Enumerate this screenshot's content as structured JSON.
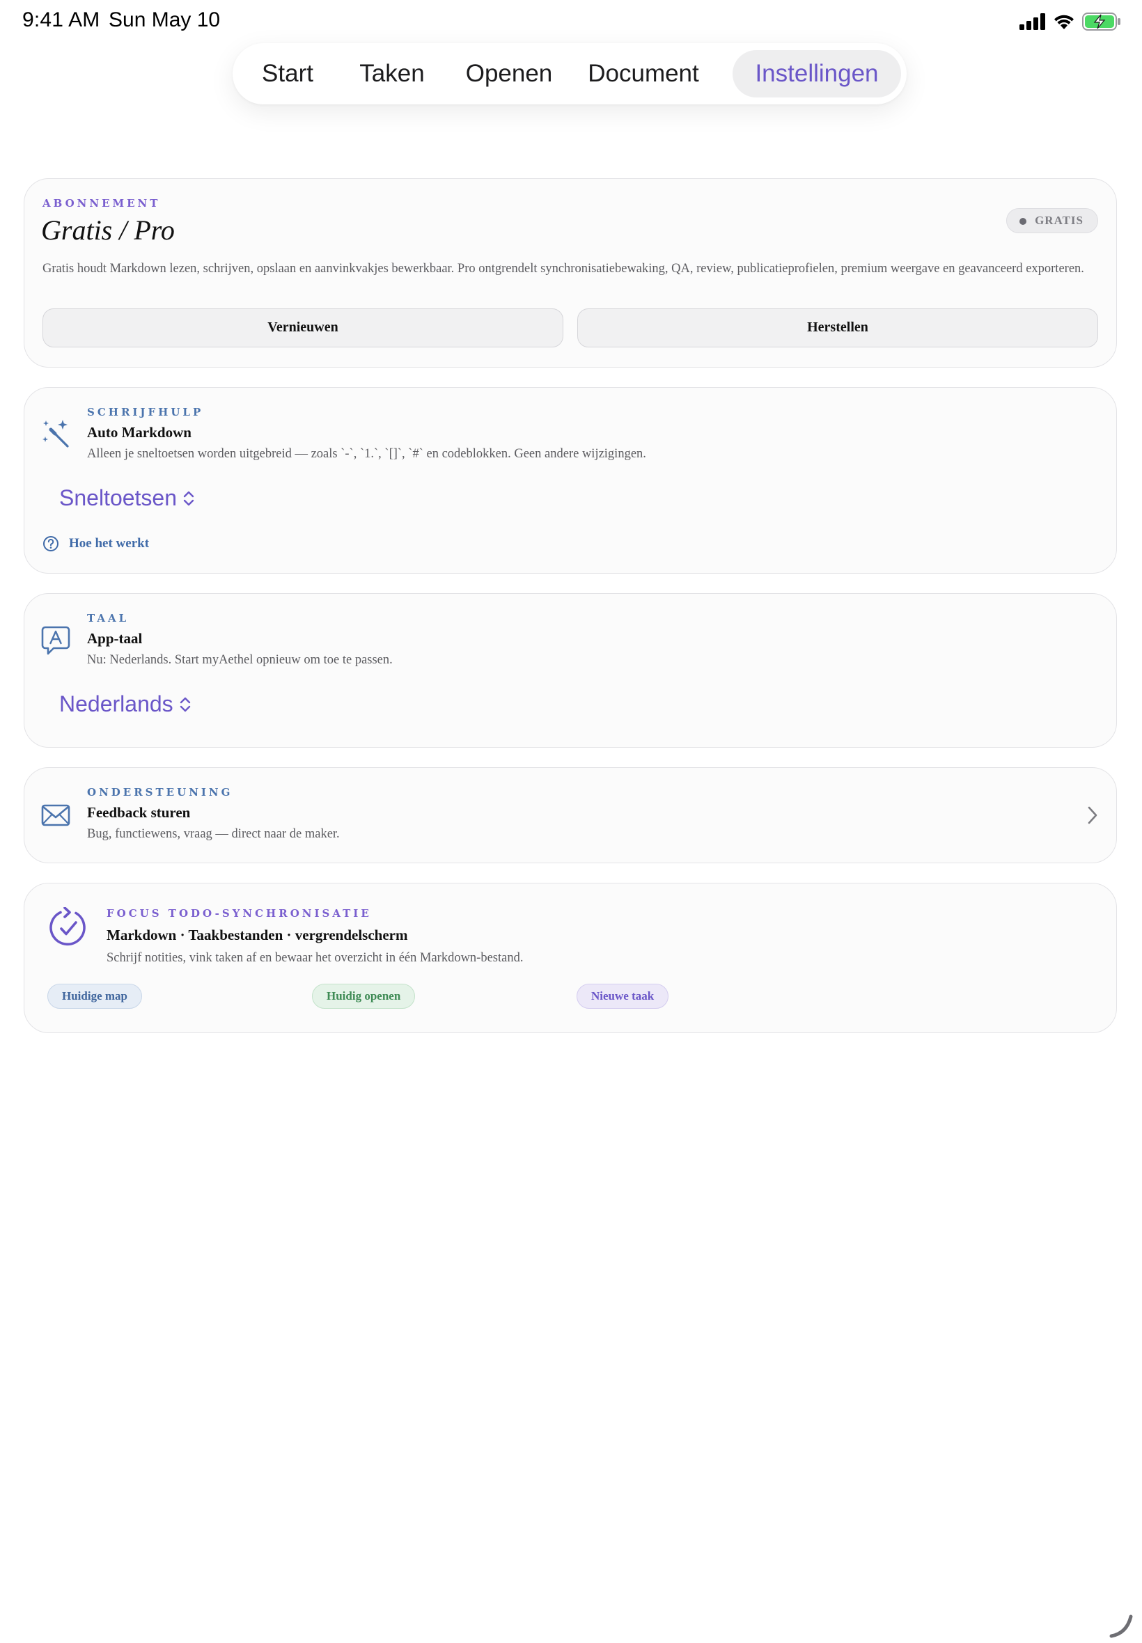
{
  "status_bar": {
    "time": "9:41 AM",
    "date": "Sun May 10",
    "icons": [
      "signal-icon",
      "wifi-icon",
      "battery-charging-icon"
    ]
  },
  "nav": {
    "tabs": [
      {
        "label": "Start",
        "active": false
      },
      {
        "label": "Taken",
        "active": false
      },
      {
        "label": "Openen",
        "active": false
      },
      {
        "label": "Document",
        "active": false
      },
      {
        "label": "Instellingen",
        "active": true
      }
    ]
  },
  "subscription": {
    "eyebrow": "ABONNEMENT",
    "title": "Gratis / Pro",
    "badge": "GRATIS",
    "description": "Gratis houdt Markdown lezen, schrijven, opslaan en aanvinkvakjes bewerkbaar. Pro ontgrendelt synchronisatiebewaking, QA, review, publicatieprofielen, premium weergave en geavanceerd exporteren.",
    "renew_label": "Vernieuwen",
    "restore_label": "Herstellen"
  },
  "writing_aid": {
    "eyebrow": "SCHRIJFHULP",
    "icon": "magic-wand-icon",
    "title": "Auto Markdown",
    "description": "Alleen je sneltoetsen worden uitgebreid — zoals `-`, `1.`, `[]`, `#` en codeblokken. Geen andere wijzigingen.",
    "picker_value": "Sneltoetsen",
    "help_link": "Hoe het werkt"
  },
  "language": {
    "eyebrow": "TAAL",
    "icon": "language-bubble-icon",
    "title": "App-taal",
    "description": "Nu: Nederlands. Start myAethel opnieuw om toe te passen.",
    "picker_value": "Nederlands"
  },
  "support": {
    "eyebrow": "ONDERSTEUNING",
    "icon": "envelope-icon",
    "title": "Feedback sturen",
    "description": "Bug, functiewens, vraag — direct naar de maker."
  },
  "focus_sync": {
    "eyebrow": "FOCUS TODO-SYNCHRONISATIE",
    "icon": "sync-check-icon",
    "title": "Markdown · Taakbestanden · vergrendelscherm",
    "description": "Schrijf notities, vink taken af en bewaar het overzicht in één Markdown-bestand.",
    "chips": [
      "Huidige map",
      "Huidig openen",
      "Nieuwe taak"
    ]
  },
  "colors": {
    "accent": "#6a56c8",
    "blue": "#4b74ad",
    "card_background": "#fbfbfb",
    "card_border": "#e3e3e6"
  }
}
